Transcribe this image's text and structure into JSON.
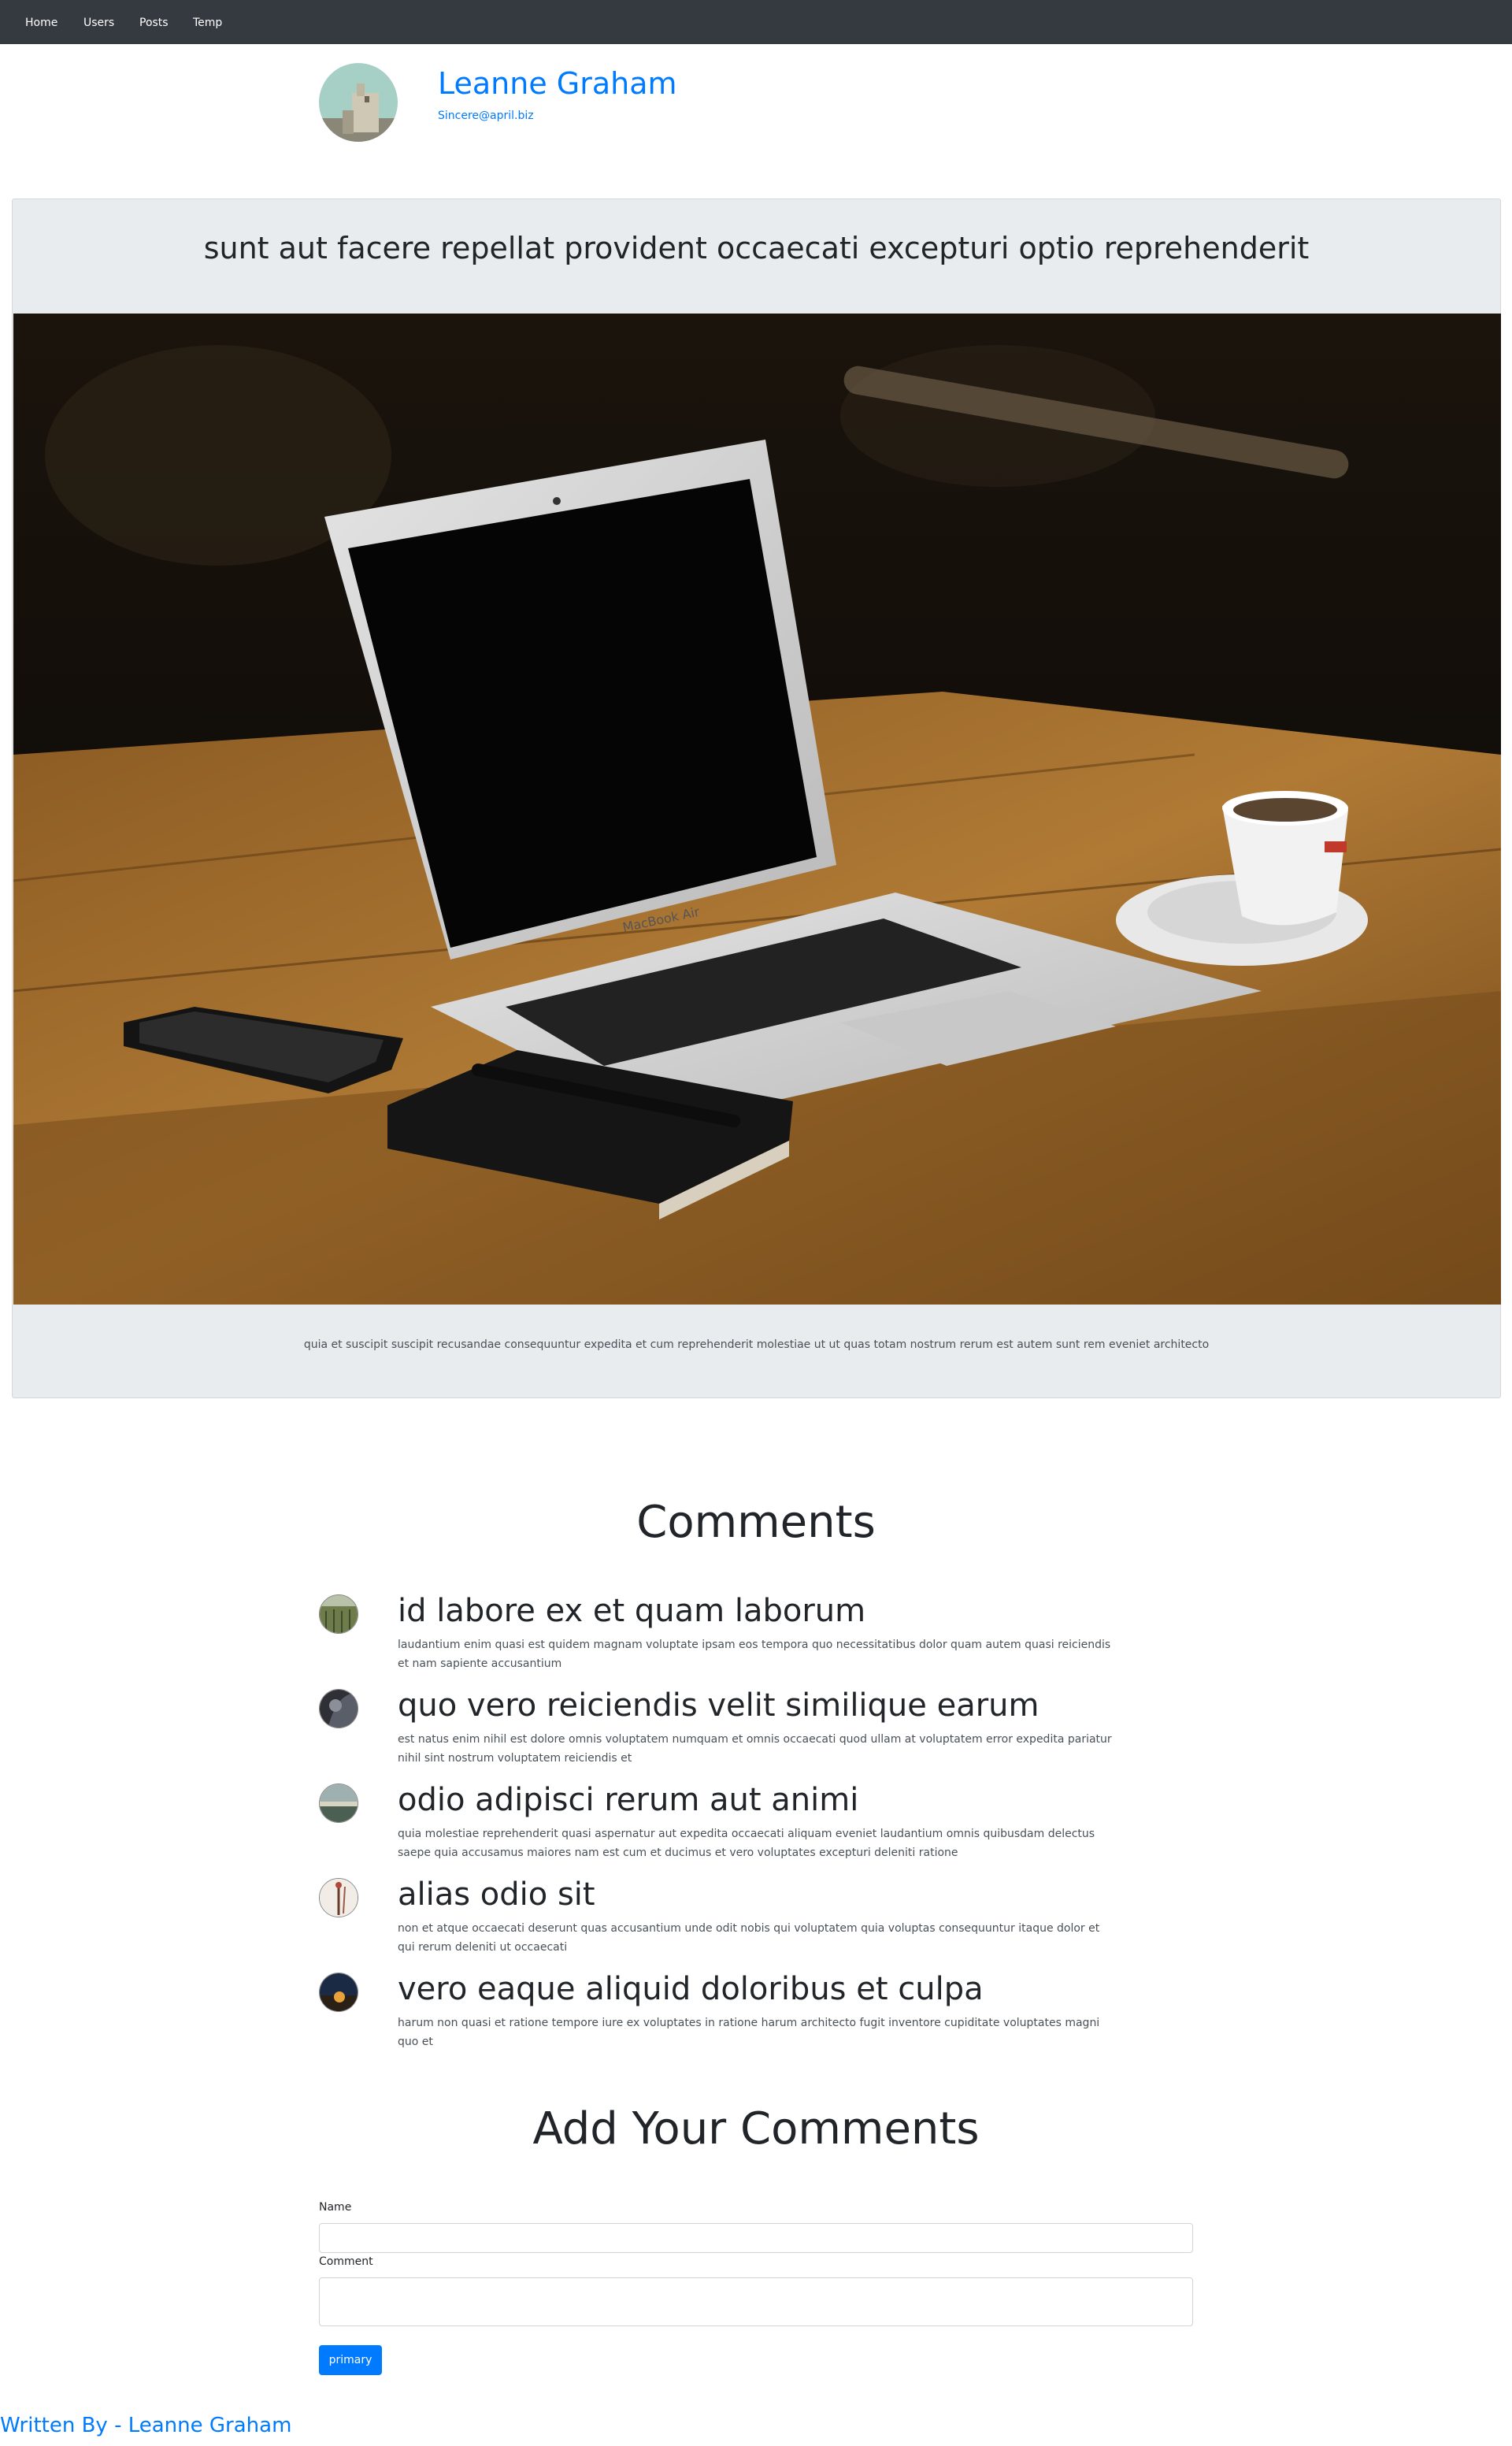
{
  "nav": {
    "items": [
      {
        "label": "Home"
      },
      {
        "label": "Users"
      },
      {
        "label": "Posts"
      },
      {
        "label": "Temp"
      }
    ]
  },
  "author": {
    "name": "Leanne Graham",
    "email": "Sincere@april.biz"
  },
  "post": {
    "title": "sunt aut facere repellat provident occaecati excepturi optio reprehenderit",
    "image_text": "MacBook Air",
    "body": "quia et suscipit suscipit recusandae consequuntur expedita et cum reprehenderit molestiae ut ut quas totam nostrum rerum est autem sunt rem eveniet architecto"
  },
  "comments": {
    "heading": "Comments",
    "items": [
      {
        "title": "id labore ex et quam laborum",
        "body": "laudantium enim quasi est quidem magnam voluptate ipsam eos tempora quo necessitatibus dolor quam autem quasi reiciendis et nam sapiente accusantium"
      },
      {
        "title": "quo vero reiciendis velit similique earum",
        "body": "est natus enim nihil est dolore omnis voluptatem numquam et omnis occaecati quod ullam at voluptatem error expedita pariatur nihil sint nostrum voluptatem reiciendis et"
      },
      {
        "title": "odio adipisci rerum aut animi",
        "body": "quia molestiae reprehenderit quasi aspernatur aut expedita occaecati aliquam eveniet laudantium omnis quibusdam delectus saepe quia accusamus maiores nam est cum et ducimus et vero voluptates excepturi deleniti ratione"
      },
      {
        "title": "alias odio sit",
        "body": "non et atque occaecati deserunt quas accusantium unde odit nobis qui voluptatem quia voluptas consequuntur itaque dolor et qui rerum deleniti ut occaecati"
      },
      {
        "title": "vero eaque aliquid doloribus et culpa",
        "body": "harum non quasi et ratione tempore iure ex voluptates in ratione harum architecto fugit inventore cupiditate voluptates magni quo et"
      }
    ]
  },
  "form": {
    "heading": "Add Your Comments",
    "name_label": "Name",
    "name_value": "",
    "comment_label": "Comment",
    "comment_value": "",
    "submit_label": "primary"
  },
  "footer": {
    "text": "Written By - Leanne Graham"
  },
  "colors": {
    "navbar": "#343a40",
    "accent": "#007bff",
    "card": "#e9ecef"
  }
}
